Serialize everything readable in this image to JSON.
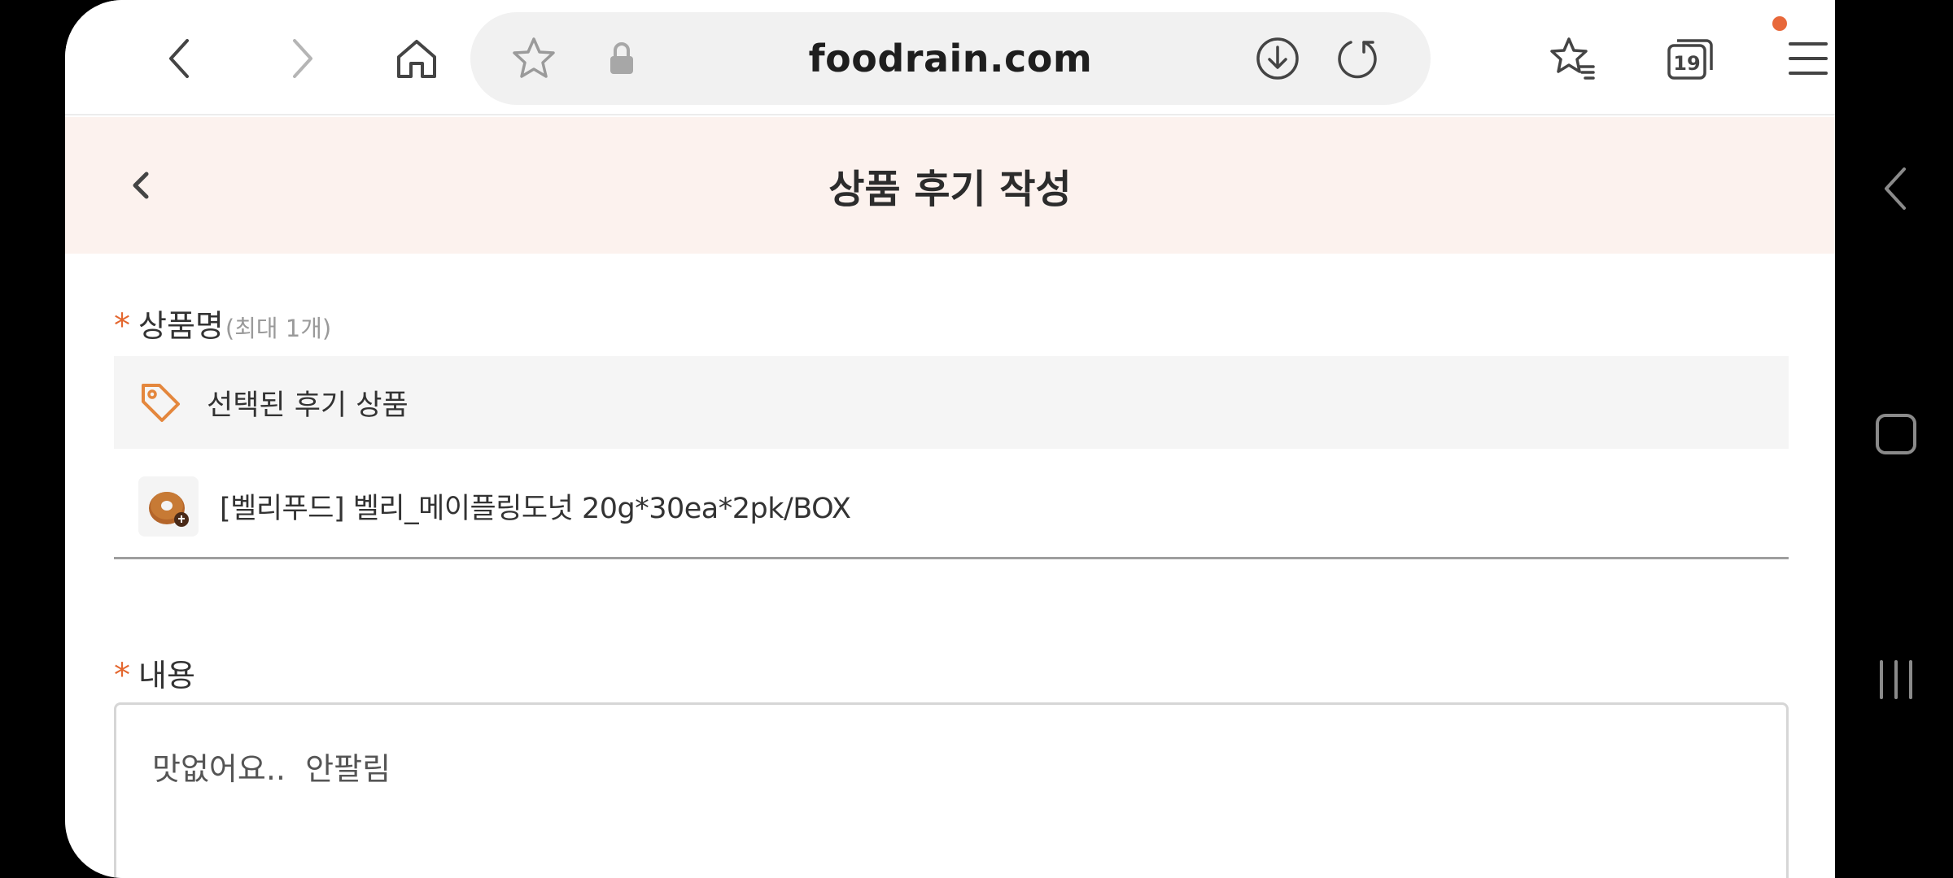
{
  "browser": {
    "url": "foodrain.com",
    "tabs_count": "19",
    "accent": "#e8683a"
  },
  "page": {
    "title": "상품 후기 작성"
  },
  "form": {
    "product_label": "상품명",
    "product_hint": "(최대 1개)",
    "required_mark": "*",
    "selected_label": "선택된 후기 상품",
    "product_name": "[벨리푸드] 벨리_메이플링도넛 20g*30ea*2pk/BOX",
    "content_label": "내용",
    "content_value": "맛없어요..  안팔림"
  },
  "colors": {
    "header_bg": "#fcf2ee",
    "required": "#e4672f",
    "tag_icon": "#e4873d"
  }
}
